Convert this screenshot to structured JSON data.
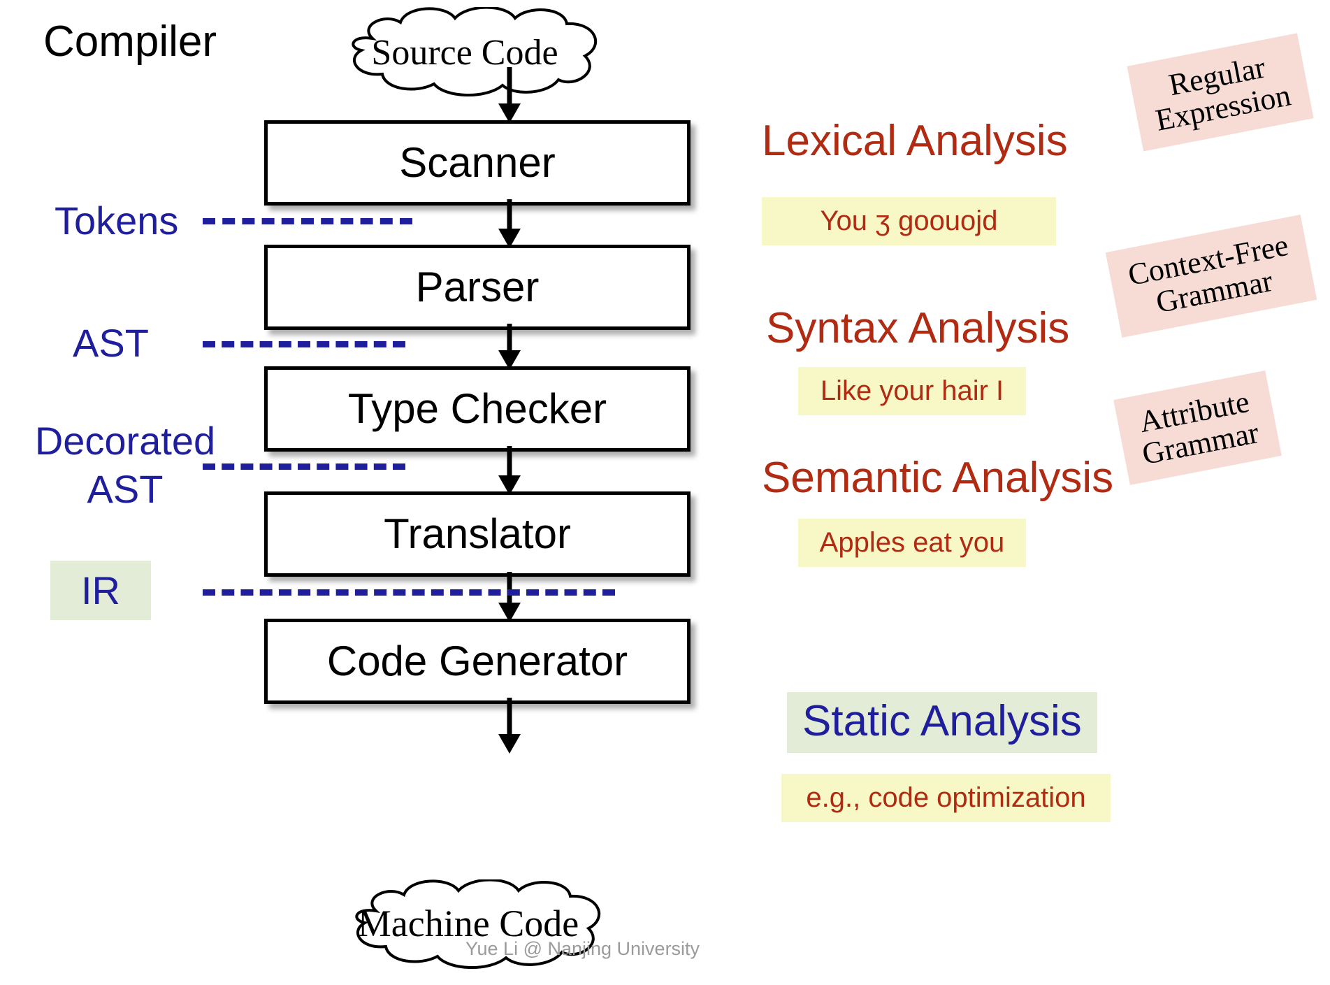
{
  "title": "Compiler",
  "clouds": {
    "input": {
      "label": "Source Code"
    },
    "output": {
      "label": "Machine Code"
    }
  },
  "stages": [
    {
      "id": "scanner",
      "label": "Scanner"
    },
    {
      "id": "parser",
      "label": "Parser"
    },
    {
      "id": "type-checker",
      "label": "Type Checker"
    },
    {
      "id": "translator",
      "label": "Translator"
    },
    {
      "id": "code-generator",
      "label": "Code Generator"
    }
  ],
  "intermediate_labels": [
    {
      "id": "tokens",
      "label": "Tokens"
    },
    {
      "id": "ast",
      "label": "AST"
    },
    {
      "id": "decorated-ast",
      "line1": "Decorated",
      "line2": "AST"
    },
    {
      "id": "ir",
      "label": "IR"
    }
  ],
  "phases": [
    {
      "id": "lexical",
      "heading": "Lexical Analysis",
      "example": "You ʒ goouojd"
    },
    {
      "id": "syntax",
      "heading": "Syntax Analysis",
      "example": "Like your hair I"
    },
    {
      "id": "semantic",
      "heading": "Semantic Analysis",
      "example": "Apples eat you"
    },
    {
      "id": "static",
      "heading": "Static Analysis",
      "example": "e.g., code optimization"
    }
  ],
  "formalism_tags": [
    {
      "id": "regular-expression",
      "line1": "Regular",
      "line2": "Expression"
    },
    {
      "id": "context-free-grammar",
      "line1": "Context-Free",
      "line2": "Grammar"
    },
    {
      "id": "attribute-grammar",
      "line1": "Attribute",
      "line2": "Grammar"
    }
  ],
  "attribution": "Yue Li @ Nanjing University",
  "colors": {
    "phase_red": "#b12a12",
    "label_blue": "#1f1f9e",
    "note_yellow": "#f8f7c6",
    "tag_pink": "#f7dbd5",
    "ir_green": "#e3ecd6",
    "box_border": "#000000"
  }
}
